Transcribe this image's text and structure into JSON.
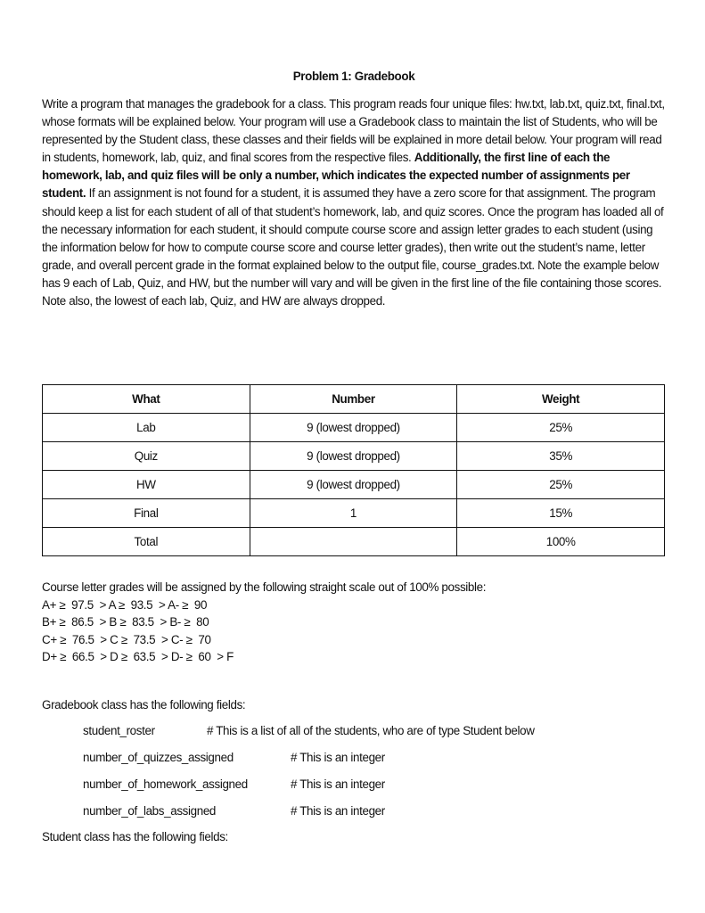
{
  "document": {
    "title": "Problem 1: Gradebook",
    "intro_parts": [
      {
        "text": "Write a program that manages the gradebook for a class. This program reads four unique files: hw.txt, lab.txt, quiz.txt, final.txt, whose formats will be explained below. Your program will use a Gradebook class to maintain the list of Students, who will be represented by the Student class, these classes and their fields will be explained in more detail below. Your program will read in students, homework, lab, quiz, and final scores from the respective files. ",
        "bold": false
      },
      {
        "text": "Additionally, the first line of each the homework, lab, and quiz files will be only a number, which indicates the expected number of assignments per student.",
        "bold": true
      },
      {
        "text": " If an assignment is not found for a student, it is assumed they have a zero score for that assignment. The program should keep a list for each student of all of that student’s homework, lab, and quiz scores. Once the program has loaded all of the necessary information for each student, it should compute course score and assign letter grades to each student (using the information below for how to compute course score and course letter grades), then write out the student’s name, letter grade, and overall percent grade in the format explained below to the output file, course_grades.txt.  Note the example below has 9 each of Lab, Quiz, and HW, but the number will vary and will be given in the first line of the file containing those scores.  Note also, the lowest of each lab, Quiz, and HW are always dropped.",
        "bold": false
      }
    ]
  },
  "weights_table": {
    "headers": [
      "What",
      "Number",
      "Weight"
    ],
    "rows": [
      [
        "Lab",
        "9 (lowest dropped)",
        "25%"
      ],
      [
        "Quiz",
        "9 (lowest dropped)",
        "35%"
      ],
      [
        "HW",
        "9 (lowest dropped)",
        "25%"
      ],
      [
        "Final",
        "1",
        "15%"
      ],
      [
        "Total",
        "",
        "100%"
      ]
    ]
  },
  "grade_scale": {
    "intro": "Course letter grades will be assigned by the following straight scale out of 100% possible:",
    "rows": [
      "A+ ≥  97.5  > A ≥  93.5  > A- ≥  90",
      "B+ ≥  86.5  > B ≥  83.5  > B- ≥  80",
      "C+ ≥  76.5  > C ≥  73.5  > C- ≥  70",
      "D+ ≥  66.5  > D ≥  63.5  > D- ≥  60  > F"
    ]
  },
  "gradebook_class": {
    "heading": "Gradebook class has the following fields:",
    "fields": [
      {
        "name": "student_roster",
        "comment": "# This is a list of all of the students, who are of type Student below"
      },
      {
        "name": "number_of_quizzes_assigned",
        "comment": "# This is an integer"
      },
      {
        "name": "number_of_homework_assigned",
        "comment": "# This is an integer"
      },
      {
        "name": "number_of_labs_assigned",
        "comment": "# This is an integer"
      }
    ]
  },
  "student_class": {
    "heading": "Student class has the following fields:"
  }
}
